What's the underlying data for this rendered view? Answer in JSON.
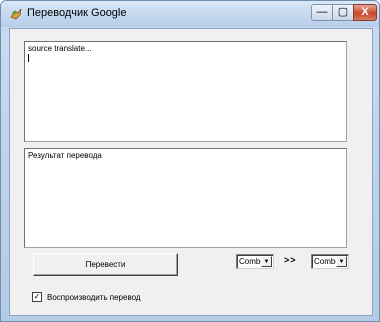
{
  "window": {
    "title": "Переводчик Google",
    "minimize_glyph": "—",
    "maximize_glyph": "▢",
    "close_glyph": "X",
    "icon": "app-bird-icon"
  },
  "source": {
    "text": "source translate..."
  },
  "result": {
    "text": "Результат перевода"
  },
  "controls": {
    "translate_label": "Перевести",
    "from_combo": "Combo",
    "to_combo": "Combo",
    "dropdown_glyph": "▼",
    "direction": ">>"
  },
  "options": {
    "play_label": "Воспроизводить перевод",
    "play_checked": true,
    "check_glyph": "✓"
  },
  "colors": {
    "titlebar": "#c6d9ef",
    "close_button": "#c9462c",
    "client_bg": "#f0f0f0"
  }
}
